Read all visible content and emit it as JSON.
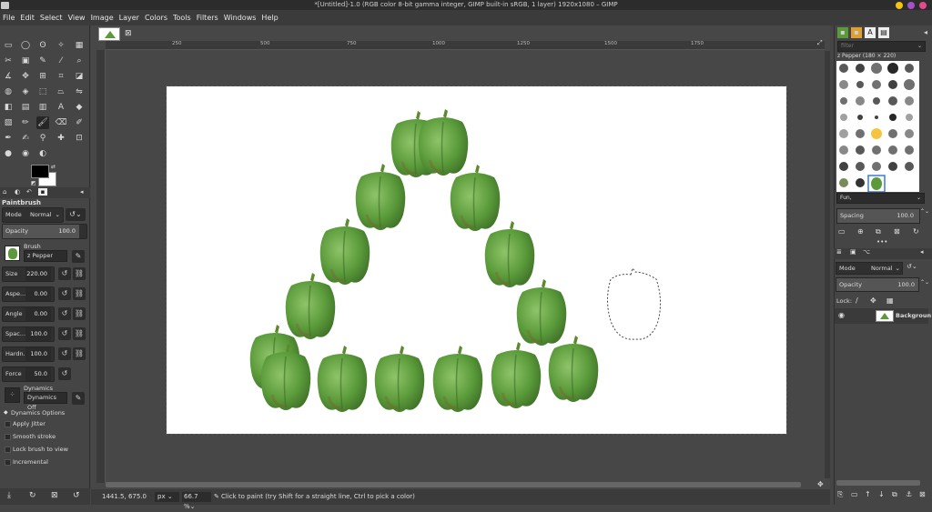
{
  "window": {
    "title": "*[Untitled]-1.0 (RGB color 8-bit gamma integer, GIMP built-in sRGB, 1 layer) 1920x1080 – GIMP"
  },
  "menu": [
    "File",
    "Edit",
    "Select",
    "View",
    "Image",
    "Layer",
    "Colors",
    "Tools",
    "Filters",
    "Windows",
    "Help"
  ],
  "tool_options": {
    "title": "Paintbrush",
    "mode_label": "Mode",
    "mode_value": "Normal",
    "opacity_label": "Opacity",
    "opacity_value": "100.0",
    "brush_label": "Brush",
    "brush_value": "z Pepper",
    "size_label": "Size",
    "size_value": "220.00",
    "aspect_label": "Aspe...",
    "aspect_value": "0.00",
    "angle_label": "Angle",
    "angle_value": "0.00",
    "spacing_label": "Spac...",
    "spacing_value": "100.0",
    "hardness_label": "Hardn...",
    "hardness_value": "100.0",
    "force_label": "Force",
    "force_value": "50.0",
    "dynamics_label": "Dynamics",
    "dynamics_value": "Dynamics Off",
    "dynamics_options": "Dynamics Options",
    "apply_jitter": "Apply Jitter",
    "smooth_stroke": "Smooth stroke",
    "lock_brush": "Lock brush to view",
    "incremental": "Incremental"
  },
  "rulers": {
    "h": [
      "250",
      "500",
      "750",
      "1000",
      "1250",
      "1500",
      "1750"
    ]
  },
  "status": {
    "coords": "1441.5, 675.0",
    "unit": "px",
    "zoom": "66.7 %",
    "message": "Click to paint (try Shift for a straight line, Ctrl to pick a color)"
  },
  "brushes": {
    "filter_placeholder": "filter",
    "selected": "z Pepper (180 × 220)",
    "tag": "Fun,",
    "spacing_label": "Spacing",
    "spacing_value": "100.0"
  },
  "layers": {
    "mode_label": "Mode",
    "mode_value": "Normal",
    "opacity_label": "Opacity",
    "opacity_value": "100.0",
    "lock_label": "Lock:",
    "layer_name": "Backgroun"
  },
  "colors": {
    "fg": "#000000",
    "bg": "#ffffff",
    "pepper": "#5a9a3a",
    "pepper_dark": "#3d6e27"
  }
}
